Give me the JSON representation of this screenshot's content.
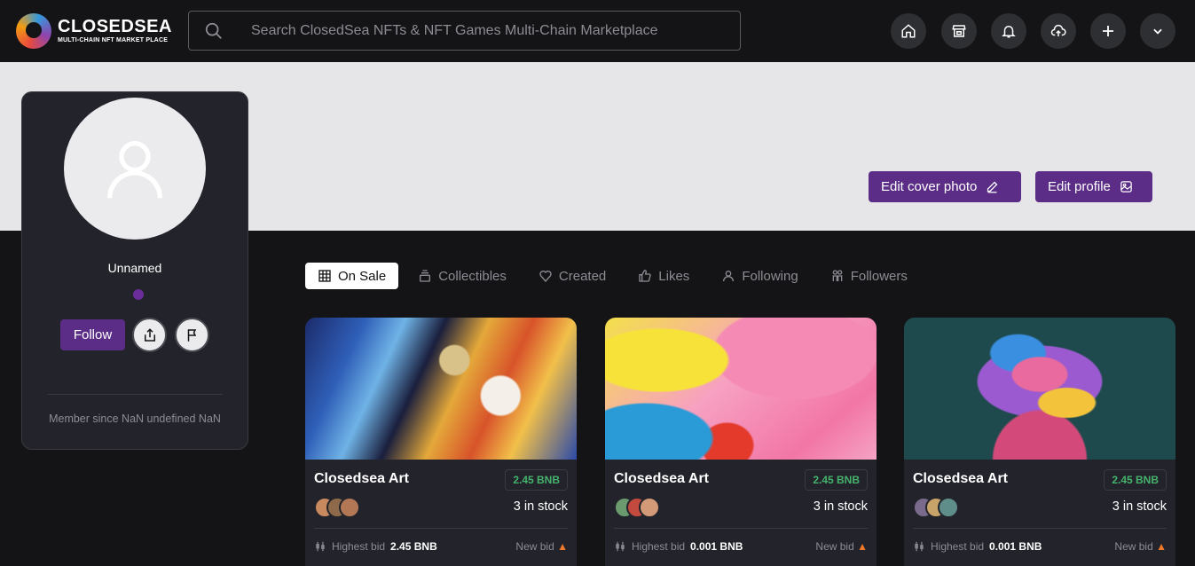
{
  "brand": {
    "name": "CLOSEDSEA",
    "tagline": "MULTI-CHAIN NFT MARKET PLACE"
  },
  "search": {
    "placeholder": "Search ClosedSea NFTs & NFT Games Multi-Chain Marketplace"
  },
  "header_buttons": [
    "home-icon",
    "store-icon",
    "bell-icon",
    "upload-icon",
    "plus-icon",
    "chevron-down-icon"
  ],
  "cover": {
    "edit_cover_label": "Edit cover photo",
    "edit_profile_label": "Edit profile"
  },
  "profile": {
    "name": "Unnamed",
    "follow_label": "Follow",
    "member_since": "Member since NaN undefined NaN"
  },
  "tabs": [
    {
      "label": "On Sale",
      "icon": "grid-icon",
      "active": true
    },
    {
      "label": "Collectibles",
      "icon": "stack-icon",
      "active": false
    },
    {
      "label": "Created",
      "icon": "heart-icon",
      "active": false
    },
    {
      "label": "Likes",
      "icon": "thumbs-up-icon",
      "active": false
    },
    {
      "label": "Following",
      "icon": "user-icon",
      "active": false
    },
    {
      "label": "Followers",
      "icon": "users-icon",
      "active": false
    }
  ],
  "cards": [
    {
      "title": "Closedsea Art",
      "price": "2.45 BNB",
      "stock": "3 in stock",
      "highest_bid_label": "Highest bid",
      "highest_bid_value": "2.45 BNB",
      "new_bid_label": "New bid"
    },
    {
      "title": "Closedsea Art",
      "price": "2.45 BNB",
      "stock": "3 in stock",
      "highest_bid_label": "Highest bid",
      "highest_bid_value": "0.001 BNB",
      "new_bid_label": "New bid"
    },
    {
      "title": "Closedsea Art",
      "price": "2.45 BNB",
      "stock": "3 in stock",
      "highest_bid_label": "Highest bid",
      "highest_bid_value": "0.001 BNB",
      "new_bid_label": "New bid"
    }
  ],
  "colors": {
    "accent": "#5b2d86",
    "price_green": "#45b26b",
    "background": "#141416",
    "card": "#23242b"
  }
}
